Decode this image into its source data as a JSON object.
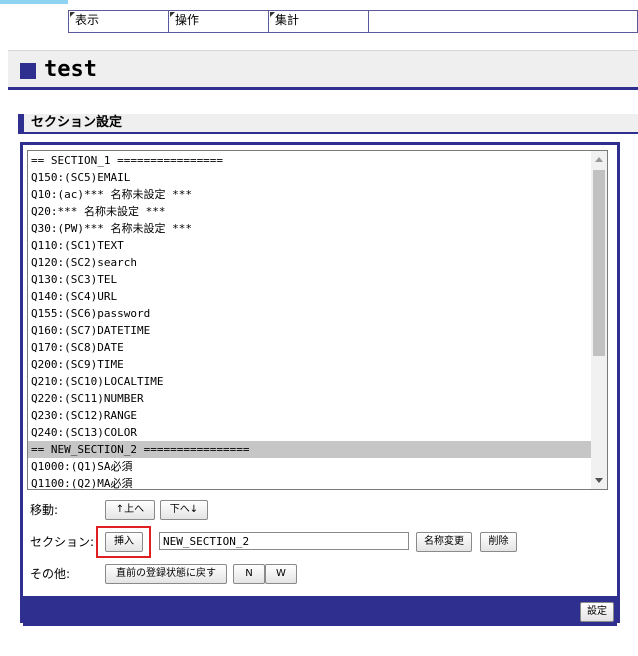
{
  "nav": {
    "items": [
      {
        "label": "表示"
      },
      {
        "label": "操作"
      },
      {
        "label": "集計"
      }
    ]
  },
  "page": {
    "title": "test"
  },
  "section": {
    "heading": "セクション設定",
    "list": {
      "items": [
        "== SECTION_1 ================",
        "Q150:(SC5)EMAIL",
        "Q10:(ac)*** 名称未設定 ***",
        "Q20:*** 名称未設定 ***",
        "Q30:(PW)*** 名称未設定 ***",
        "Q110:(SC1)TEXT",
        "Q120:(SC2)search",
        "Q130:(SC3)TEL",
        "Q140:(SC4)URL",
        "Q155:(SC6)password",
        "Q160:(SC7)DATETIME",
        "Q170:(SC8)DATE",
        "Q200:(SC9)TIME",
        "Q210:(SC10)LOCALTIME",
        "Q220:(SC11)NUMBER",
        "Q230:(SC12)RANGE",
        "Q240:(SC13)COLOR",
        "== NEW_SECTION_2 ================",
        "Q1000:(Q1)SA必須",
        "Q1100:(Q2)MA必須"
      ],
      "selected_index": 17
    },
    "move": {
      "label": "移動:",
      "up_button": "↑上へ",
      "down_button": "下へ↓"
    },
    "section_row": {
      "label": "セクション:",
      "insert_button": "挿入",
      "name_value": "NEW_SECTION_2",
      "rename_button": "名称変更",
      "delete_button": "削除"
    },
    "other": {
      "label": "その他:",
      "revert_button": "直前の登録状態に戻す",
      "n_button": "N",
      "w_button": "W"
    },
    "submit_button": "設定"
  }
}
